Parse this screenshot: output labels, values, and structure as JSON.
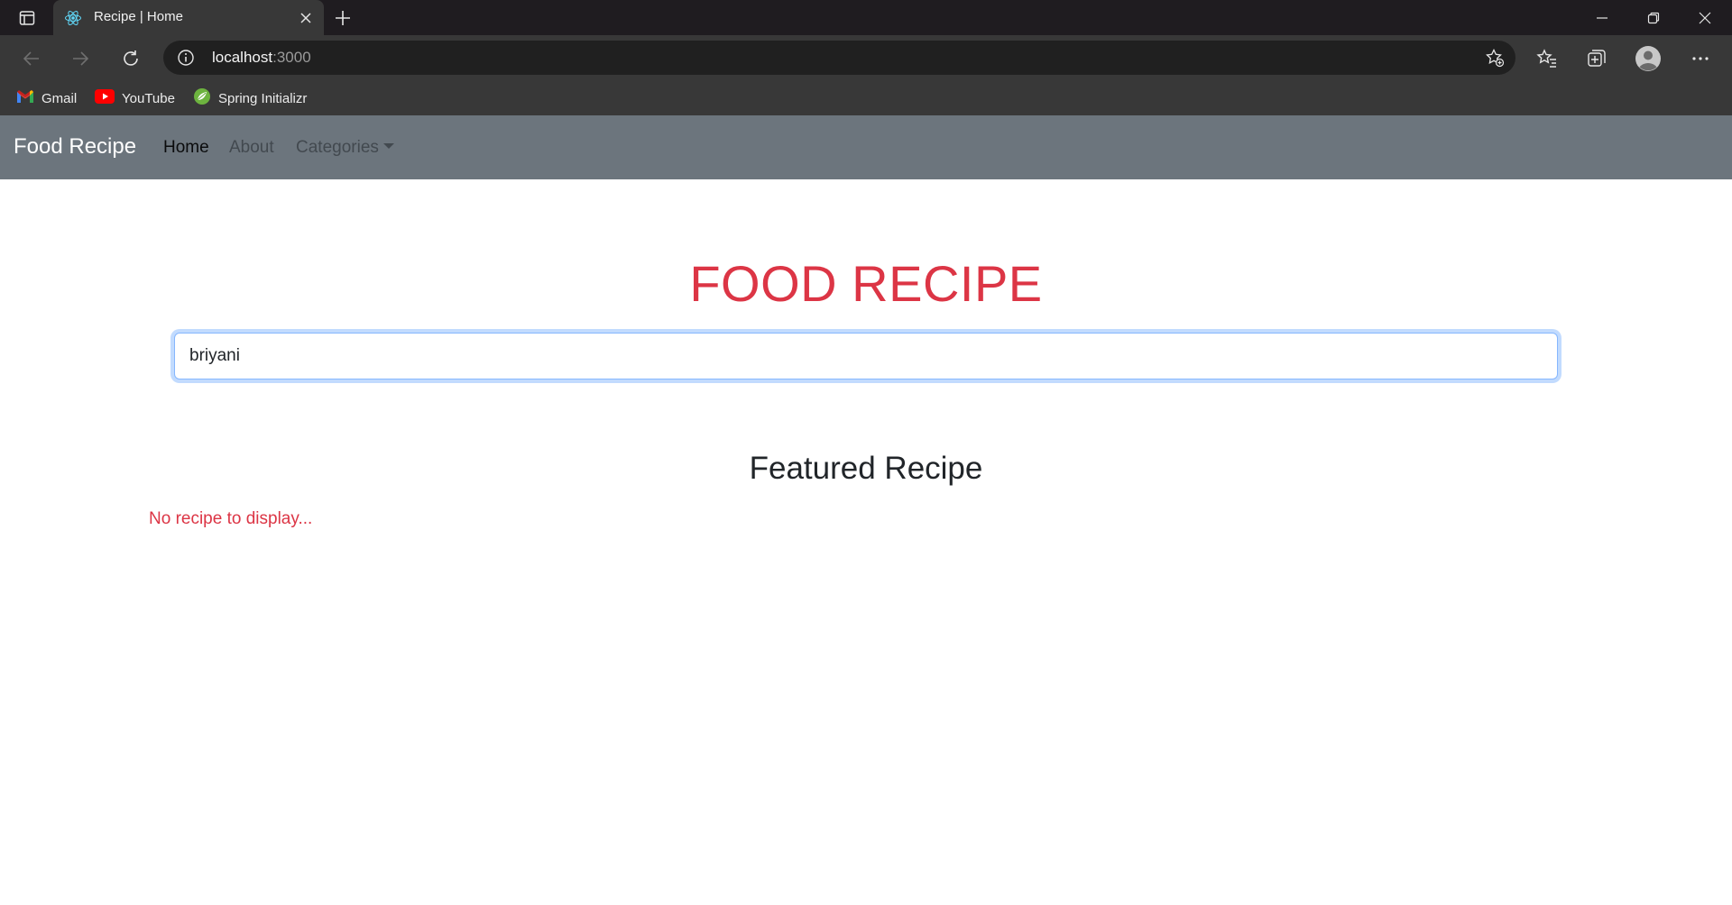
{
  "browser": {
    "tab_title": "Recipe | Home",
    "url_host": "localhost",
    "url_port": ":3000",
    "bookmarks": [
      {
        "label": "Gmail",
        "icon": "gmail-icon"
      },
      {
        "label": "YouTube",
        "icon": "youtube-icon"
      },
      {
        "label": "Spring Initializr",
        "icon": "spring-icon"
      }
    ]
  },
  "navbar": {
    "brand": "Food Recipe",
    "links": [
      {
        "label": "Home",
        "active": true
      },
      {
        "label": "About",
        "active": false
      },
      {
        "label": "Categories",
        "active": false,
        "dropdown": true
      }
    ]
  },
  "main": {
    "title": "FOOD RECIPE",
    "search_value": "briyani",
    "featured_heading": "Featured Recipe",
    "empty_message": "No recipe to display..."
  },
  "colors": {
    "navbar_bg": "#6c757d",
    "accent_red": "#dc3545",
    "input_focus": "#86b7fe"
  }
}
